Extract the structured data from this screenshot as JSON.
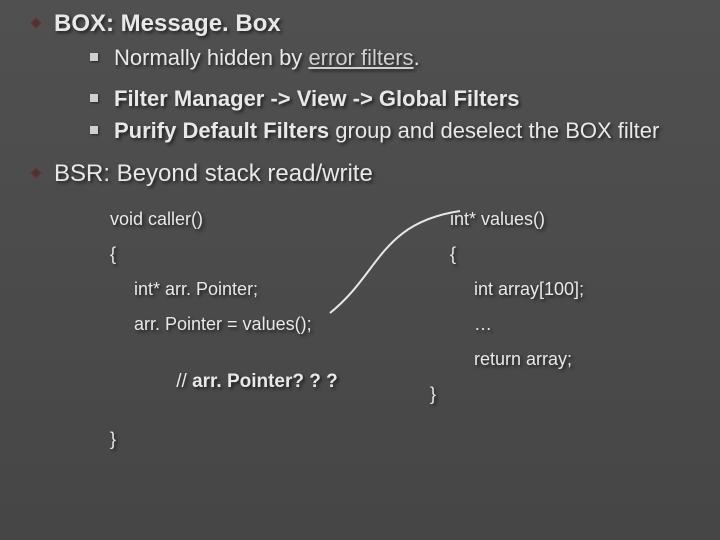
{
  "box": {
    "heading": "BOX: Message. Box",
    "sub1_prefix": "Normally hidden by ",
    "sub1_link": "error filters",
    "sub1_suffix": ".",
    "sub2_html_bold1": "Filter Manager -> View -> Global Filters",
    "sub3_bold": "Purify Default Filters",
    "sub3_rest": " group and deselect the BOX filter"
  },
  "bsr": {
    "heading": "BSR: Beyond stack read/write"
  },
  "code": {
    "left": {
      "l1": "void caller()",
      "l2": "{",
      "l3": "int* arr. Pointer;",
      "l4": "arr. Pointer = values();",
      "l5_prefix": "// ",
      "l5_bold": "arr. Pointer? ? ?",
      "l6": "}"
    },
    "right": {
      "l1": "int* values()",
      "l2": "{",
      "l3": "int array[100];",
      "l4": "…",
      "l5": "return array;",
      "l6": "}"
    }
  }
}
